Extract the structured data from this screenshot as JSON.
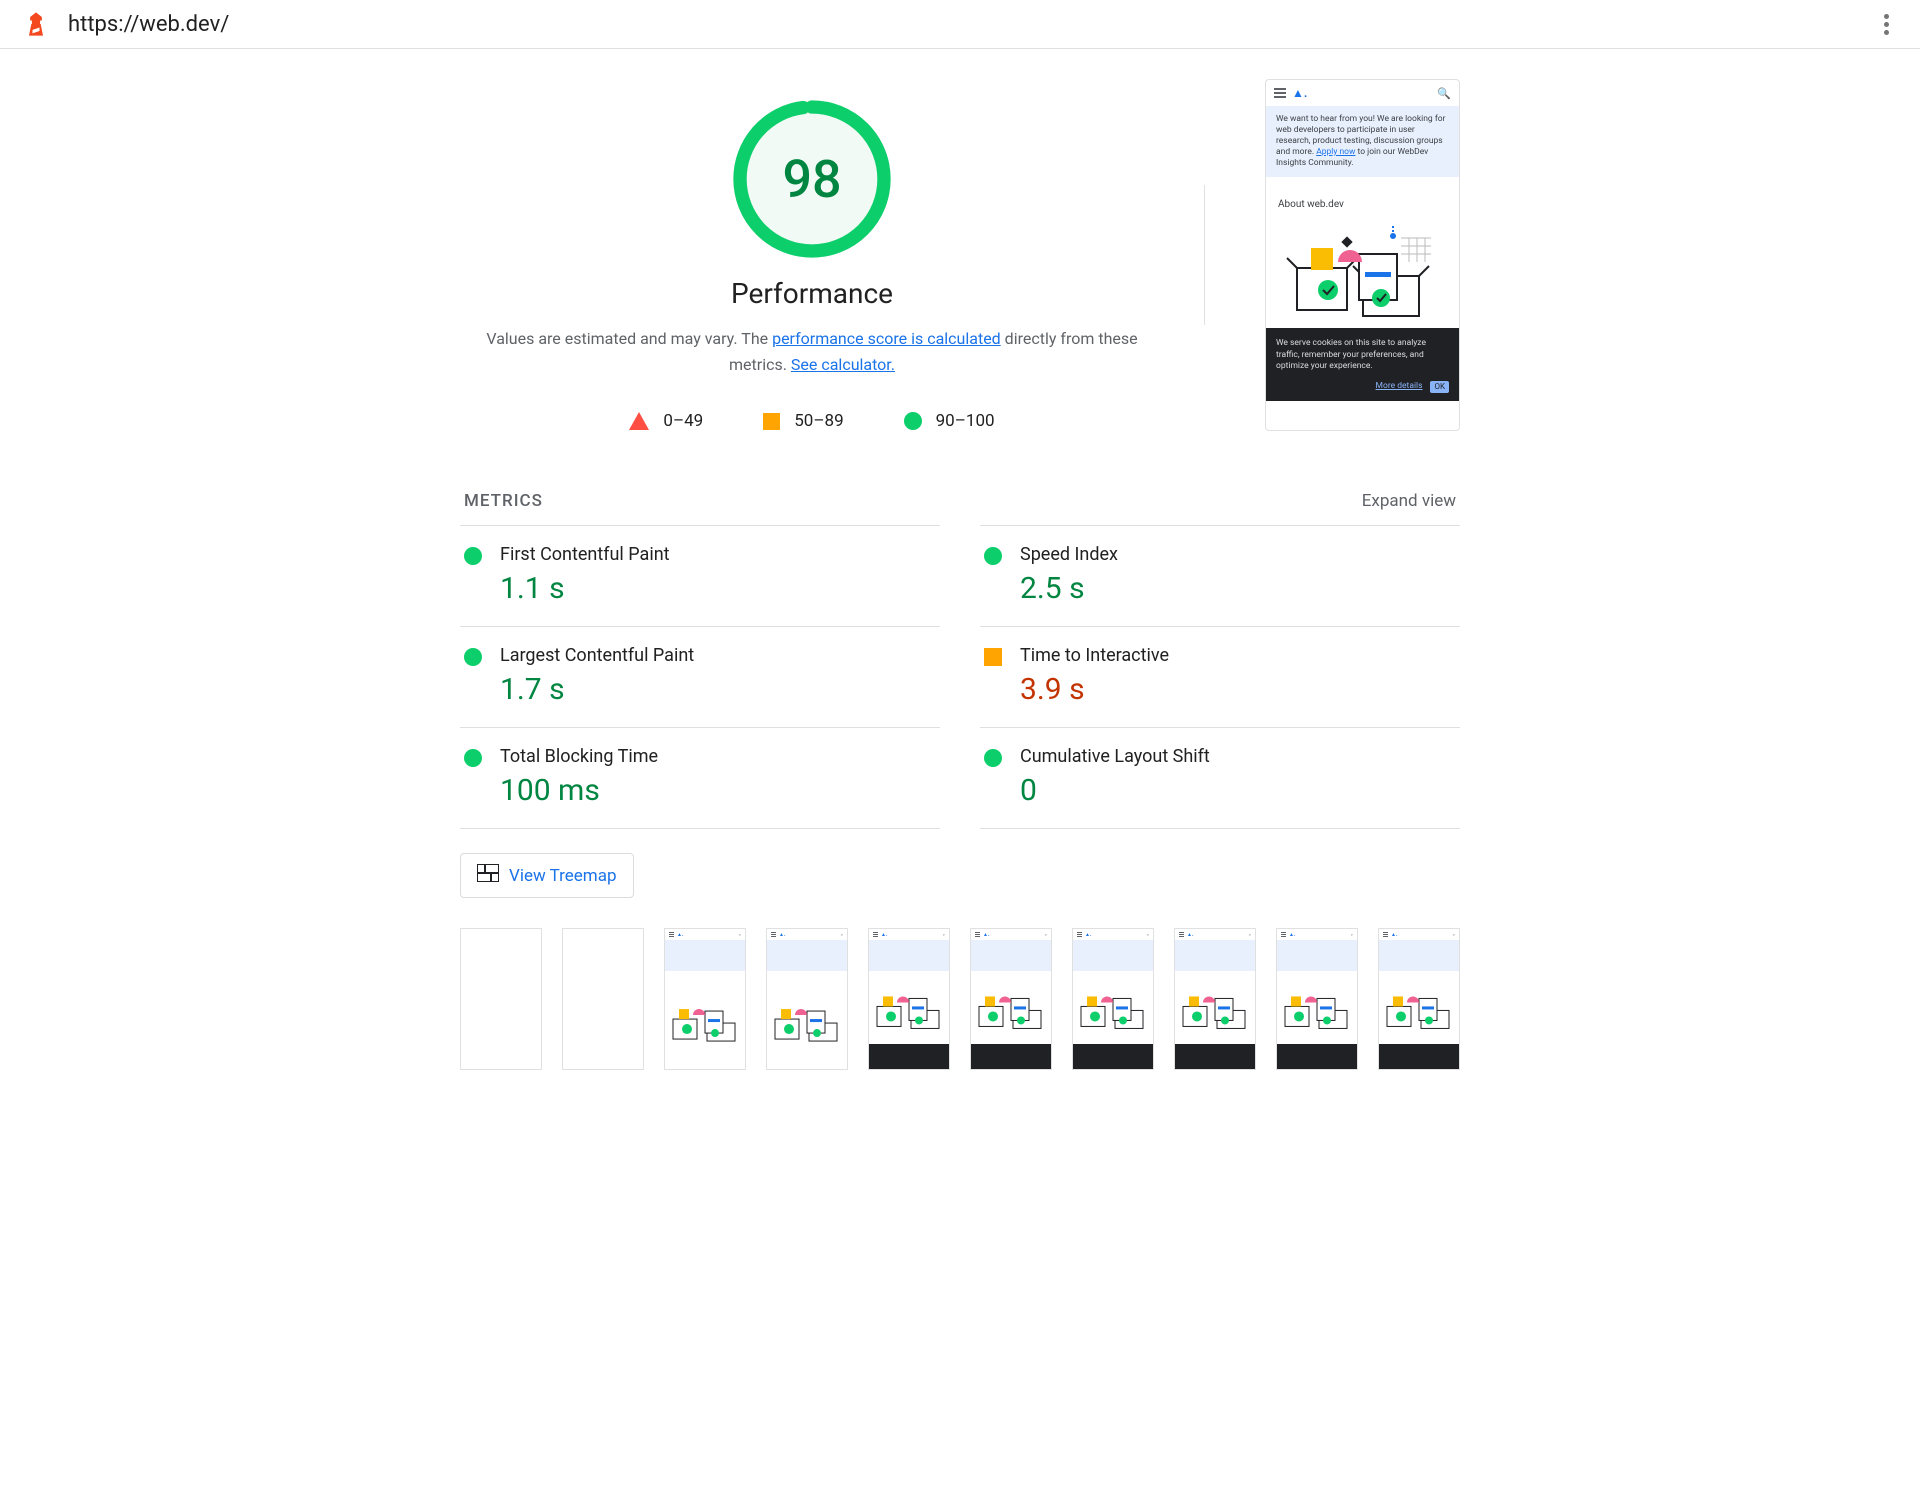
{
  "topbar": {
    "url": "https://web.dev/"
  },
  "score": {
    "value": "98",
    "title": "Performance",
    "desc_prefix": "Values are estimated and may vary. The ",
    "link1": "performance score is calculated",
    "desc_mid": " directly from these metrics. ",
    "link2": "See calculator."
  },
  "legend": {
    "fail": "0–49",
    "avg": "50–89",
    "pass": "90–100"
  },
  "preview": {
    "banner_prefix": "We want to hear from you! We are looking for web developers to participate in user research, product testing, discussion groups and more. ",
    "banner_link": "Apply now",
    "banner_suffix": " to join our WebDev Insights Community.",
    "about": "About web.dev",
    "cookie": "We serve cookies on this site to analyze traffic, remember your preferences, and optimize your experience.",
    "more": "More details",
    "ok": "OK"
  },
  "metrics": {
    "heading": "METRICS",
    "expand": "Expand view",
    "items": [
      {
        "label": "First Contentful Paint",
        "value": "1.1 s",
        "status": "pass"
      },
      {
        "label": "Speed Index",
        "value": "2.5 s",
        "status": "pass"
      },
      {
        "label": "Largest Contentful Paint",
        "value": "1.7 s",
        "status": "pass"
      },
      {
        "label": "Time to Interactive",
        "value": "3.9 s",
        "status": "avg"
      },
      {
        "label": "Total Blocking Time",
        "value": "100 ms",
        "status": "pass"
      },
      {
        "label": "Cumulative Layout Shift",
        "value": "0",
        "status": "pass"
      }
    ]
  },
  "treemap": {
    "label": "View Treemap"
  },
  "colors": {
    "pass": "#0cce6b",
    "avg": "#ffa400",
    "fail": "#ff4e42"
  }
}
